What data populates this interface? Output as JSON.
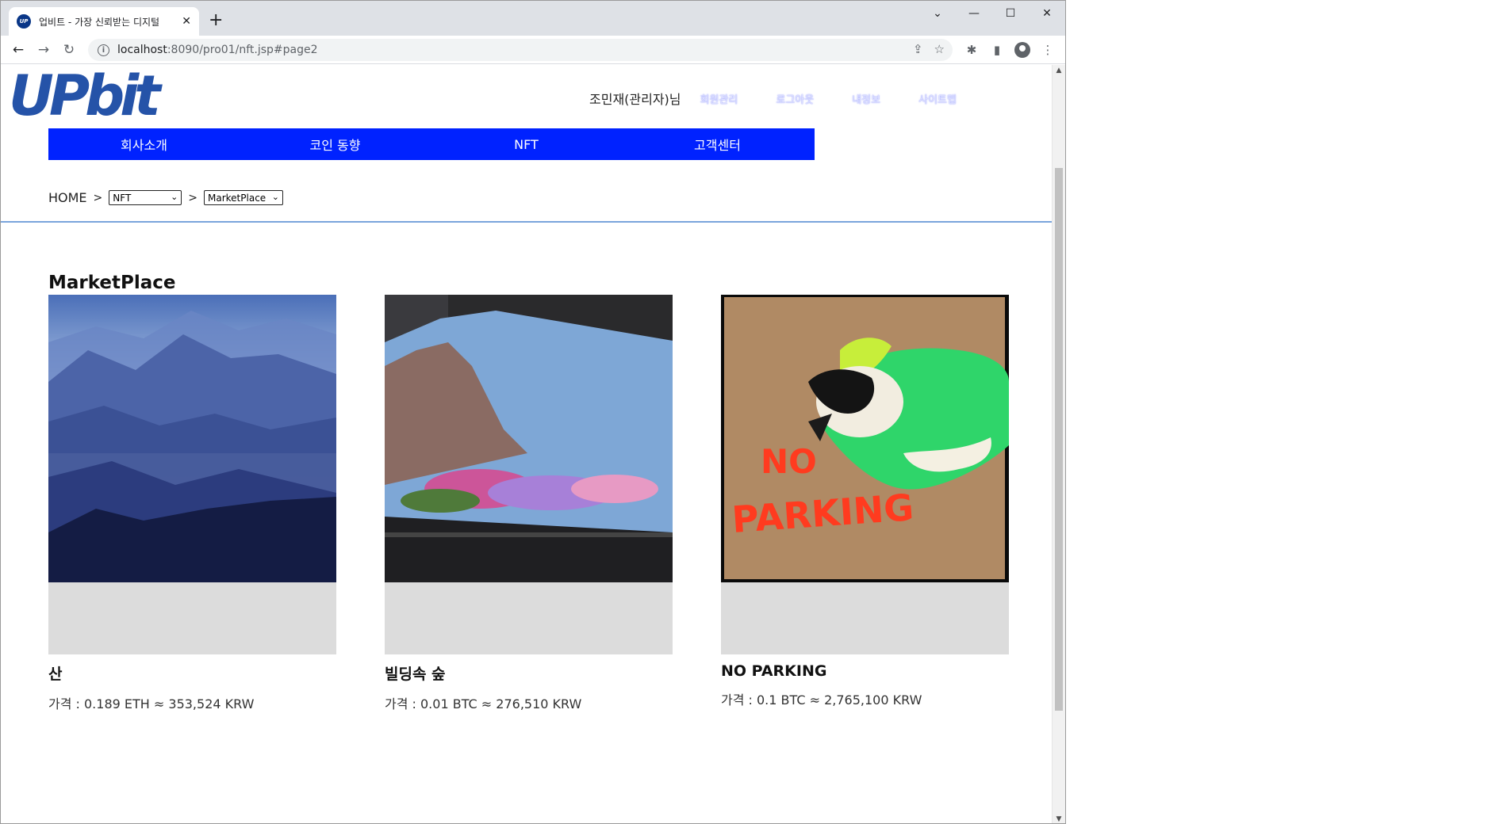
{
  "browser": {
    "tab_title": "업비트 - 가장 신뢰받는 디지털",
    "tab_favicon": "UP",
    "new_tab": "+",
    "url_host": "localhost",
    "url_rest": ":8090/pro01/nft.jsp#page2",
    "win_minimize": "—",
    "win_maximize": "☐",
    "win_close": "✕",
    "win_chevron": "⌄"
  },
  "site": {
    "logo_text": "UPbit",
    "user_label": "조민재(관리자)님",
    "user_links": [
      "회원관리",
      "로그아웃",
      "내정보",
      "사이트맵"
    ],
    "nav": [
      "회사소개",
      "코인 동향",
      "NFT",
      "고객센터"
    ],
    "breadcrumb": {
      "home": "HOME",
      "sep": ">",
      "category": "NFT",
      "page": "MarketPlace"
    },
    "section_title": "MarketPlace",
    "items": [
      {
        "name": "산",
        "price": "가격 : 0.189 ETH ≈ 353,524 KRW"
      },
      {
        "name": "빌딩속 숲",
        "price": "가격 : 0.01 BTC ≈ 276,510 KRW"
      },
      {
        "name": "NO PARKING",
        "price": "가격 : 0.1 BTC ≈ 2,765,100 KRW"
      }
    ],
    "artwork_text": {
      "line1": "NO",
      "line2": "PARKING"
    }
  },
  "colors": {
    "nav_bg": "#0022ff",
    "logo": "#2553a8",
    "divider": "#7aa4dc"
  }
}
